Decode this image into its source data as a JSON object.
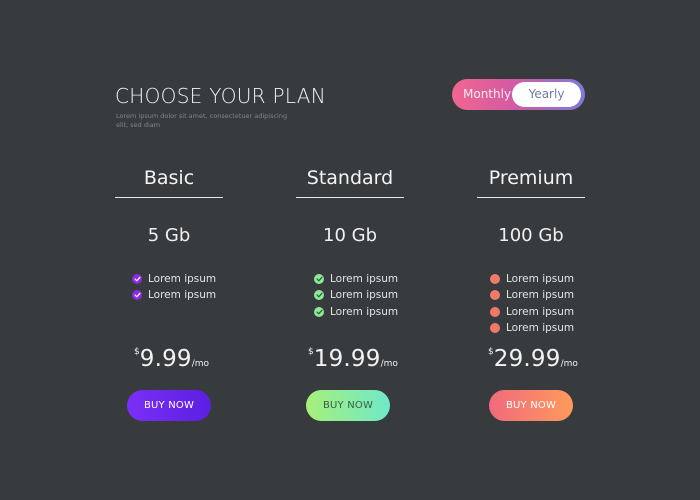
{
  "header": {
    "title": "CHOOSE YOUR PLAN",
    "subtitle": "Lorem ipsum dolor sit amet, consectetuer adipiscing elit, sed diam"
  },
  "billing_toggle": {
    "monthly_label": "Monthly",
    "yearly_label": "Yearly",
    "selected": "Yearly"
  },
  "plans": [
    {
      "name": "Basic",
      "storage": "5 Gb",
      "features": [
        "Lorem ipsum",
        "Lorem ipsum"
      ],
      "feature_icon": "check-icon",
      "currency": "$",
      "price": "9.99",
      "period": "/mo",
      "button_label": "BUY NOW",
      "colors": {
        "dot": "#8a2be2",
        "button_start": "#7b2ff7",
        "button_end": "#5b1fe0"
      }
    },
    {
      "name": "Standard",
      "storage": "10 Gb",
      "features": [
        "Lorem ipsum",
        "Lorem ipsum",
        "Lorem ipsum"
      ],
      "feature_icon": "check-icon",
      "currency": "$",
      "price": "19.99",
      "period": "/mo",
      "button_label": "BUY NOW",
      "colors": {
        "dot": "#8ee89a",
        "button_start": "#a8f07a",
        "button_end": "#6fe8c8"
      }
    },
    {
      "name": "Premium",
      "storage": "100 Gb",
      "features": [
        "Lorem ipsum",
        "Lorem ipsum",
        "Lorem ipsum",
        "Lorem ipsum"
      ],
      "feature_icon": "dot-icon",
      "currency": "$",
      "price": "29.99",
      "period": "/mo",
      "button_label": "BUY NOW",
      "colors": {
        "dot": "#ef7a6a",
        "button_start": "#f06a7c",
        "button_end": "#ff9a5c"
      }
    }
  ]
}
